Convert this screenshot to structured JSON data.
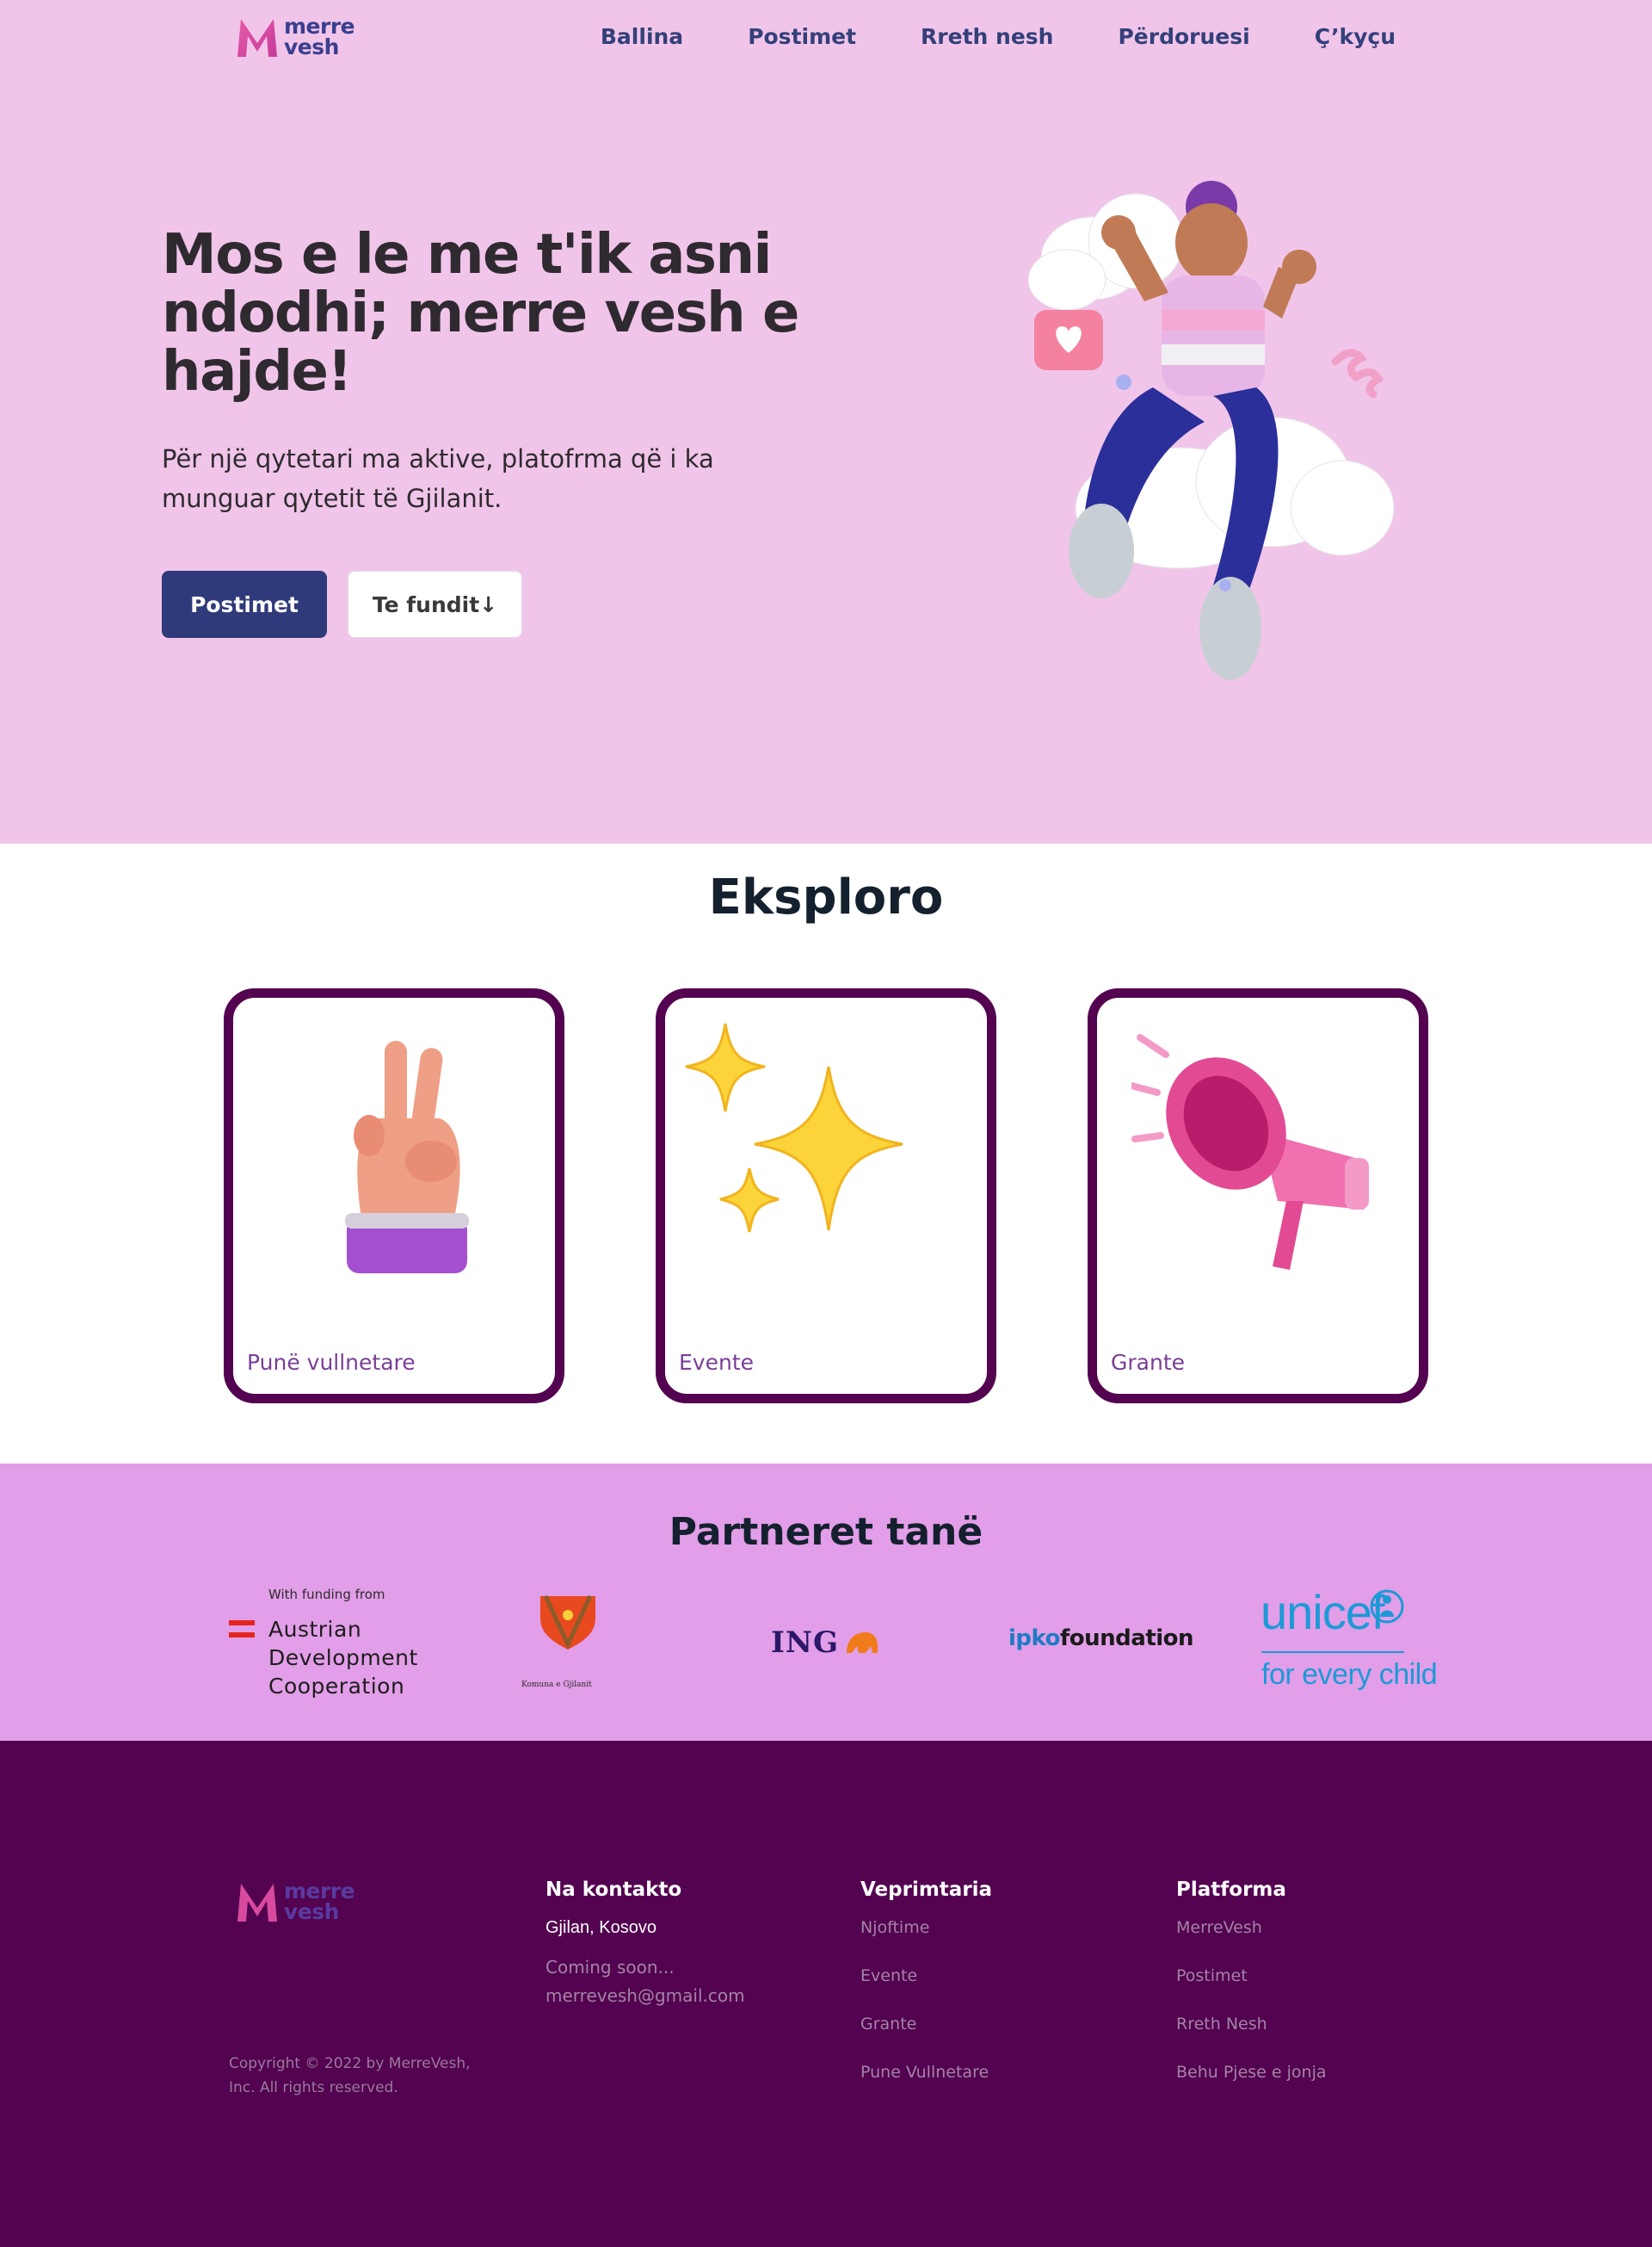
{
  "brand": {
    "name_line1": "merre",
    "name_line2": "vesh"
  },
  "nav": {
    "items": [
      {
        "label": "Ballina"
      },
      {
        "label": "Postimet"
      },
      {
        "label": "Rreth nesh"
      },
      {
        "label": "Përdoruesi"
      },
      {
        "label": "Ç’kyçu"
      }
    ]
  },
  "hero": {
    "title": "Mos e le me t'ik asni ndodhi; merre vesh e hajde!",
    "subtitle": "Për një qytetari ma aktive, platofrma që i ka munguar qytetit të Gjilanit.",
    "primary_button": "Postimet",
    "secondary_button": "Te fundit↓"
  },
  "explore": {
    "title": "Eksploro",
    "cards": [
      {
        "label": "Punë vullnetare",
        "icon": "peace-hand-icon"
      },
      {
        "label": "Evente",
        "icon": "sparkles-icon"
      },
      {
        "label": "Grante",
        "icon": "megaphone-icon"
      }
    ]
  },
  "partners": {
    "title": "Partneret tanë",
    "ada": {
      "small": "With funding from",
      "line1": "Austrian",
      "line2": "Development",
      "line3": "Cooperation"
    },
    "gjilan": {
      "caption": "Komuna e Gjilanit"
    },
    "ing": {
      "name": "ING"
    },
    "ipko": {
      "part1": "ipko",
      "part2": "foundation"
    },
    "unicef": {
      "name": "unicef",
      "tagline": "for every child"
    }
  },
  "footer": {
    "copyright": "Copyright © 2022 by MerreVesh, Inc. All rights reserved.",
    "contact": {
      "title": "Na kontakto",
      "location": "Gjilan, Kosovo",
      "line1": "Coming soon...",
      "email": "merrevesh@gmail.com"
    },
    "activity": {
      "title": "Veprimtaria",
      "items": [
        "Njoftime",
        "Evente",
        "Grante",
        "Pune Vullnetare"
      ]
    },
    "platform": {
      "title": "Platforma",
      "items": [
        "MerreVesh",
        "Postimet",
        "Rreth Nesh",
        "Behu Pjese e jonja"
      ]
    }
  },
  "colors": {
    "hero_bg": "#f1c5ea",
    "partners_bg": "#e29ee8",
    "footer_bg": "#530350",
    "primary_button": "#2f3a7a",
    "card_border": "#530350"
  }
}
